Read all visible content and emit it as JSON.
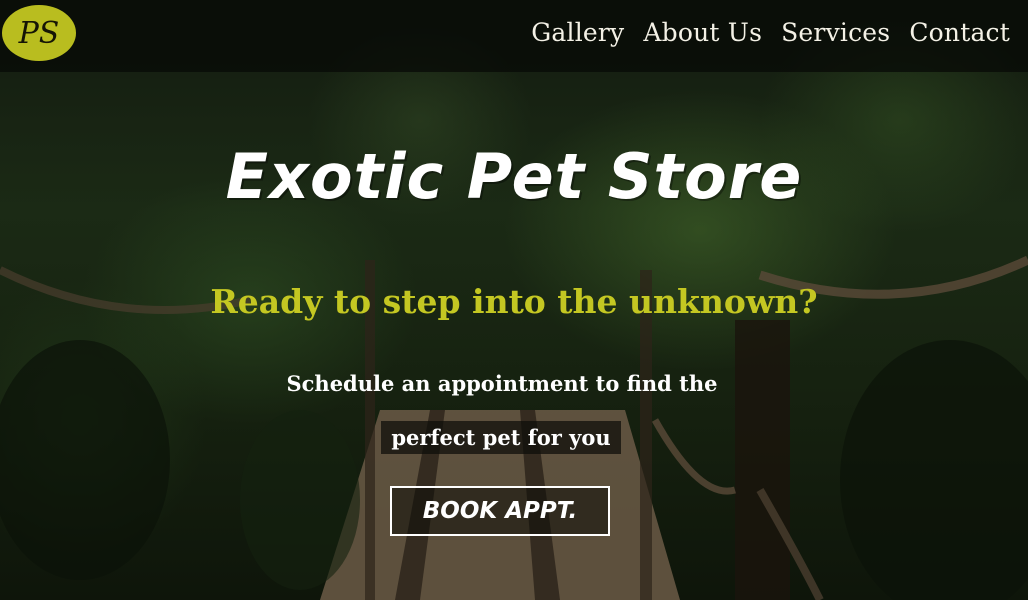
{
  "header": {
    "logo_text": "PS",
    "nav": [
      "Gallery",
      "About Us",
      "Services",
      "Contact"
    ]
  },
  "hero": {
    "title": "Exotic Pet Store",
    "subtitle": "Ready to step into the unknown?",
    "description_line1": "Schedule an appointment to find the",
    "description_line2": "perfect pet for you",
    "cta_label": "BOOK APPT."
  },
  "colors": {
    "accent": "#c4c722",
    "logo_bg": "#b9bd1f",
    "nav_bg": "#080a06",
    "text": "#ffffff"
  }
}
